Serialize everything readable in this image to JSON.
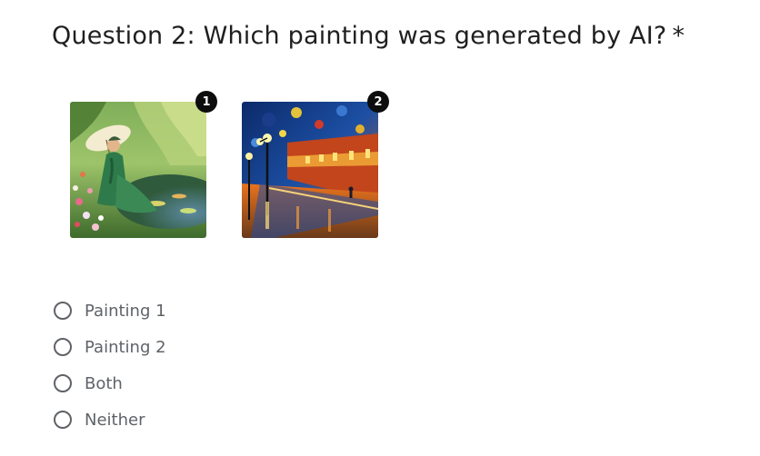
{
  "question": {
    "title": "Question 2: Which painting was generated by AI?",
    "required_mark": "*"
  },
  "paintings": [
    {
      "badge": "1",
      "subject": "woman in green dress with parasol in garden",
      "icon": "painting-image"
    },
    {
      "badge": "2",
      "subject": "rainy night street with street lamps",
      "icon": "painting-image"
    }
  ],
  "options": [
    {
      "label": "Painting 1",
      "selected": false
    },
    {
      "label": "Painting 2",
      "selected": false
    },
    {
      "label": "Both",
      "selected": false
    },
    {
      "label": "Neither",
      "selected": false
    }
  ],
  "colors": {
    "title": "#1f1f1f",
    "option_text": "#5f6368",
    "radio_border": "#5f6368",
    "badge_bg": "#0d0d0d"
  }
}
